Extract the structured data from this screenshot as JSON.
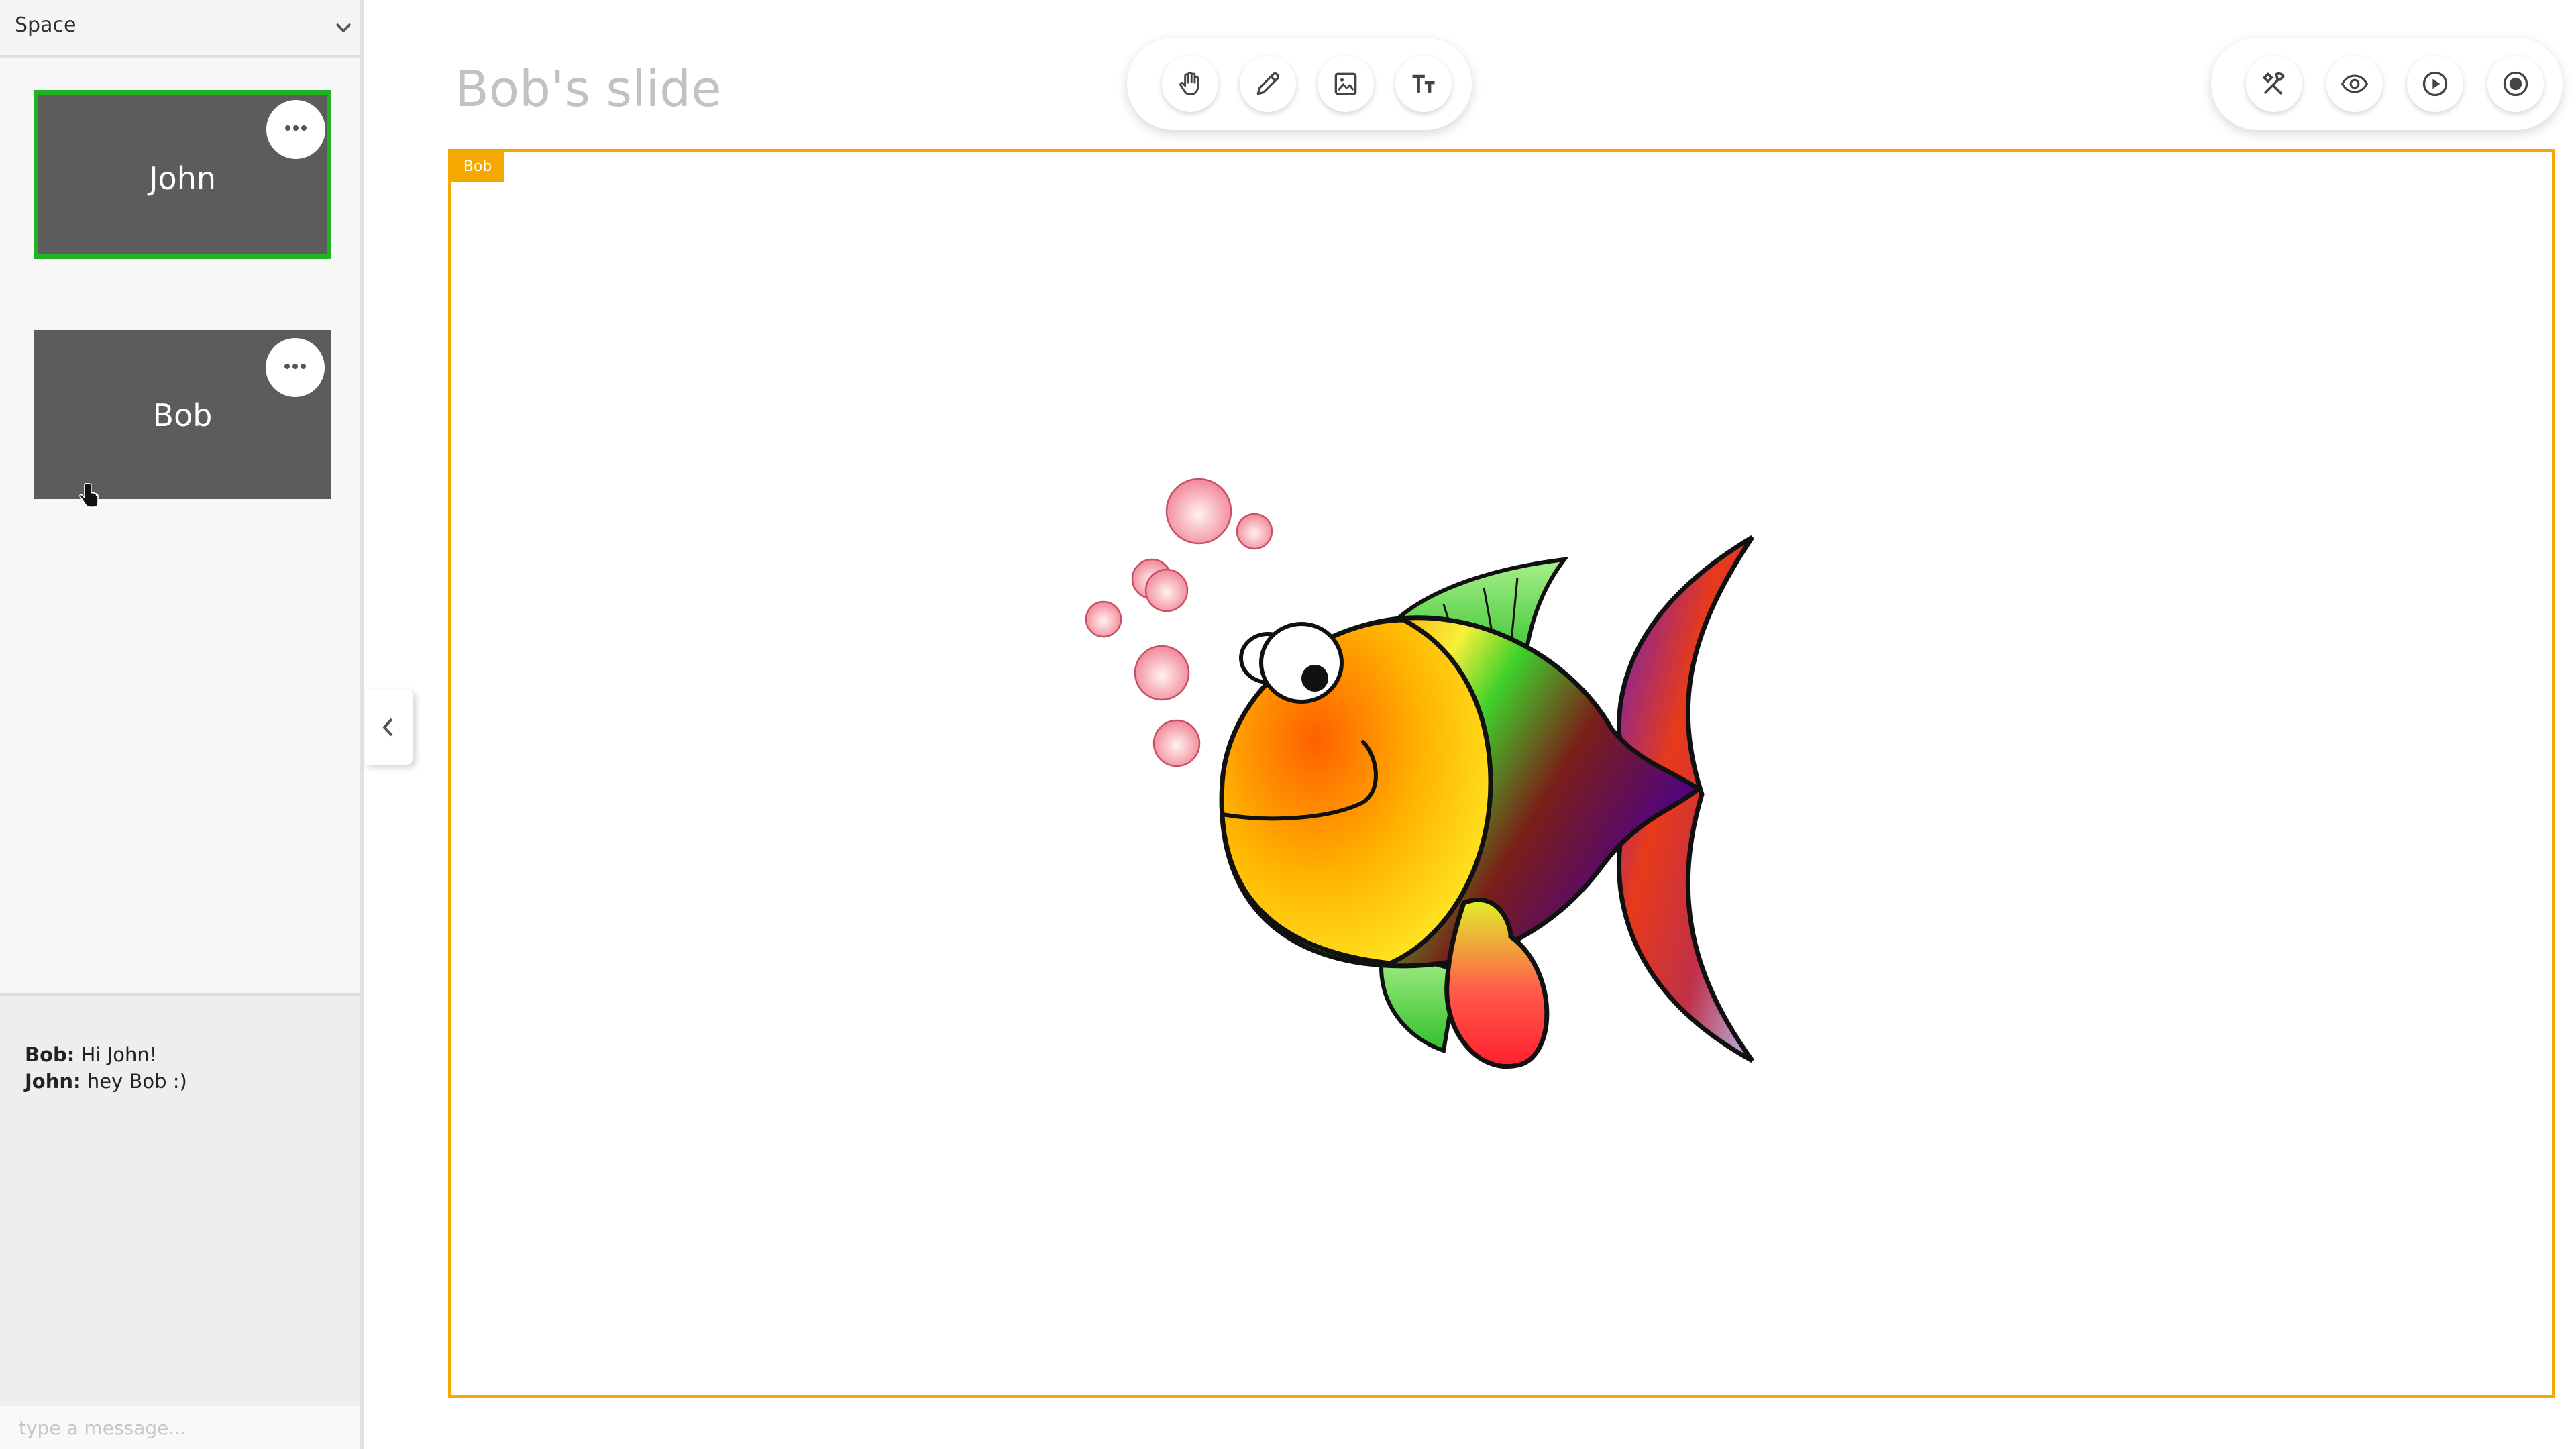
{
  "sidebar": {
    "space_label": "Space",
    "slides": [
      {
        "name": "John",
        "active": true
      },
      {
        "name": "Bob",
        "active": false
      }
    ]
  },
  "chat": {
    "messages": [
      {
        "author": "Bob:",
        "text": "Hi John!"
      },
      {
        "author": "John:",
        "text": "hey Bob :)"
      }
    ],
    "input_placeholder": "type a message..."
  },
  "main": {
    "slide_title": "Bob's slide",
    "owner_tag": "Bob"
  },
  "toolbar_left": {
    "tools": [
      "hand-icon",
      "pencil-icon",
      "image-icon",
      "text-icon"
    ]
  },
  "toolbar_right": {
    "tools": [
      "tools-icon",
      "eye-icon",
      "play-icon",
      "record-icon"
    ]
  },
  "colors": {
    "accent_orange": "#f5a800",
    "active_green": "#21b321",
    "card_gray": "#5c5c5c"
  }
}
